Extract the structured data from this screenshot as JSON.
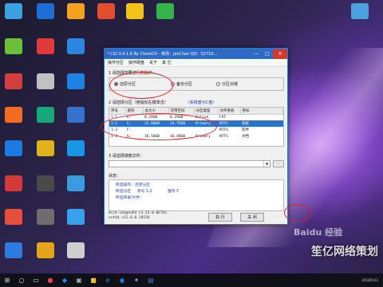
{
  "window": {
    "title": "* CGI 3.4.1.6 By CloneCD - 修改：JesChan  QQ：52710...",
    "minimize": "—",
    "maximize": "□",
    "close": "✕"
  },
  "menu": [
    "操作分区",
    "操作硬盘",
    "关于",
    "其 它"
  ],
  "operation": {
    "heading": "1 请选择您要进行的操作：",
    "options": [
      "还原分区",
      "备份分区",
      "分区对拷"
    ],
    "selected": "还原分区"
  },
  "partition": {
    "heading": "2 请选择分区（用鼠标左键单击）",
    "system_disk_link": "（系统盘为C盘）",
    "columns": [
      "序号",
      "盘符",
      "总大小",
      "可用空间",
      "分区类型",
      "文件系统",
      "卷标"
    ],
    "rows": [
      [
        "1:1",
        "E:",
        "0.29GB",
        "0.29GB",
        "Active",
        "FAT",
        ""
      ],
      [
        "1:2",
        "C:",
        "25.00GB",
        "24.75GB",
        "Primary",
        "NTFS",
        "系统"
      ],
      [
        "1:3",
        "F:",
        "",
        "",
        "",
        "NTFS",
        "软件"
      ],
      [
        "1:4",
        "G:",
        "16.58GB",
        "16.48GB",
        "Primary",
        "NTFS",
        "文档"
      ]
    ],
    "selected_row": 1
  },
  "image_file": {
    "heading": "3 请选择镜像文件：",
    "browse": "...",
    "value": ""
  },
  "status": {
    "heading": "状态：",
    "lines": [
      [
        "所选操作：还原分区",
        ""
      ],
      [
        "所选分区",
        "序号 1:2",
        "盘符 C"
      ],
      [
        "所选目录/文件：",
        ""
      ]
    ]
  },
  "log": {
    "line1": "mlib-imagex64 v1.12.0-BETA1",
    "line2": "ost64 v12.0.0.10520"
  },
  "buttons": {
    "execute": "执 行",
    "close": "关 闭"
  },
  "desktop": {
    "icons": [
      "",
      "",
      "",
      "",
      "",
      "",
      "",
      "",
      ""
    ],
    "watermark": "笙亿网络策划",
    "watermark_date": "2018/5/22",
    "baidu": "Baidu 经验"
  },
  "colors": {
    "title_bar": "#2e6bc6",
    "selection": "#2a72d0",
    "annotation": "#e02020",
    "link": "#1a3fa8"
  }
}
